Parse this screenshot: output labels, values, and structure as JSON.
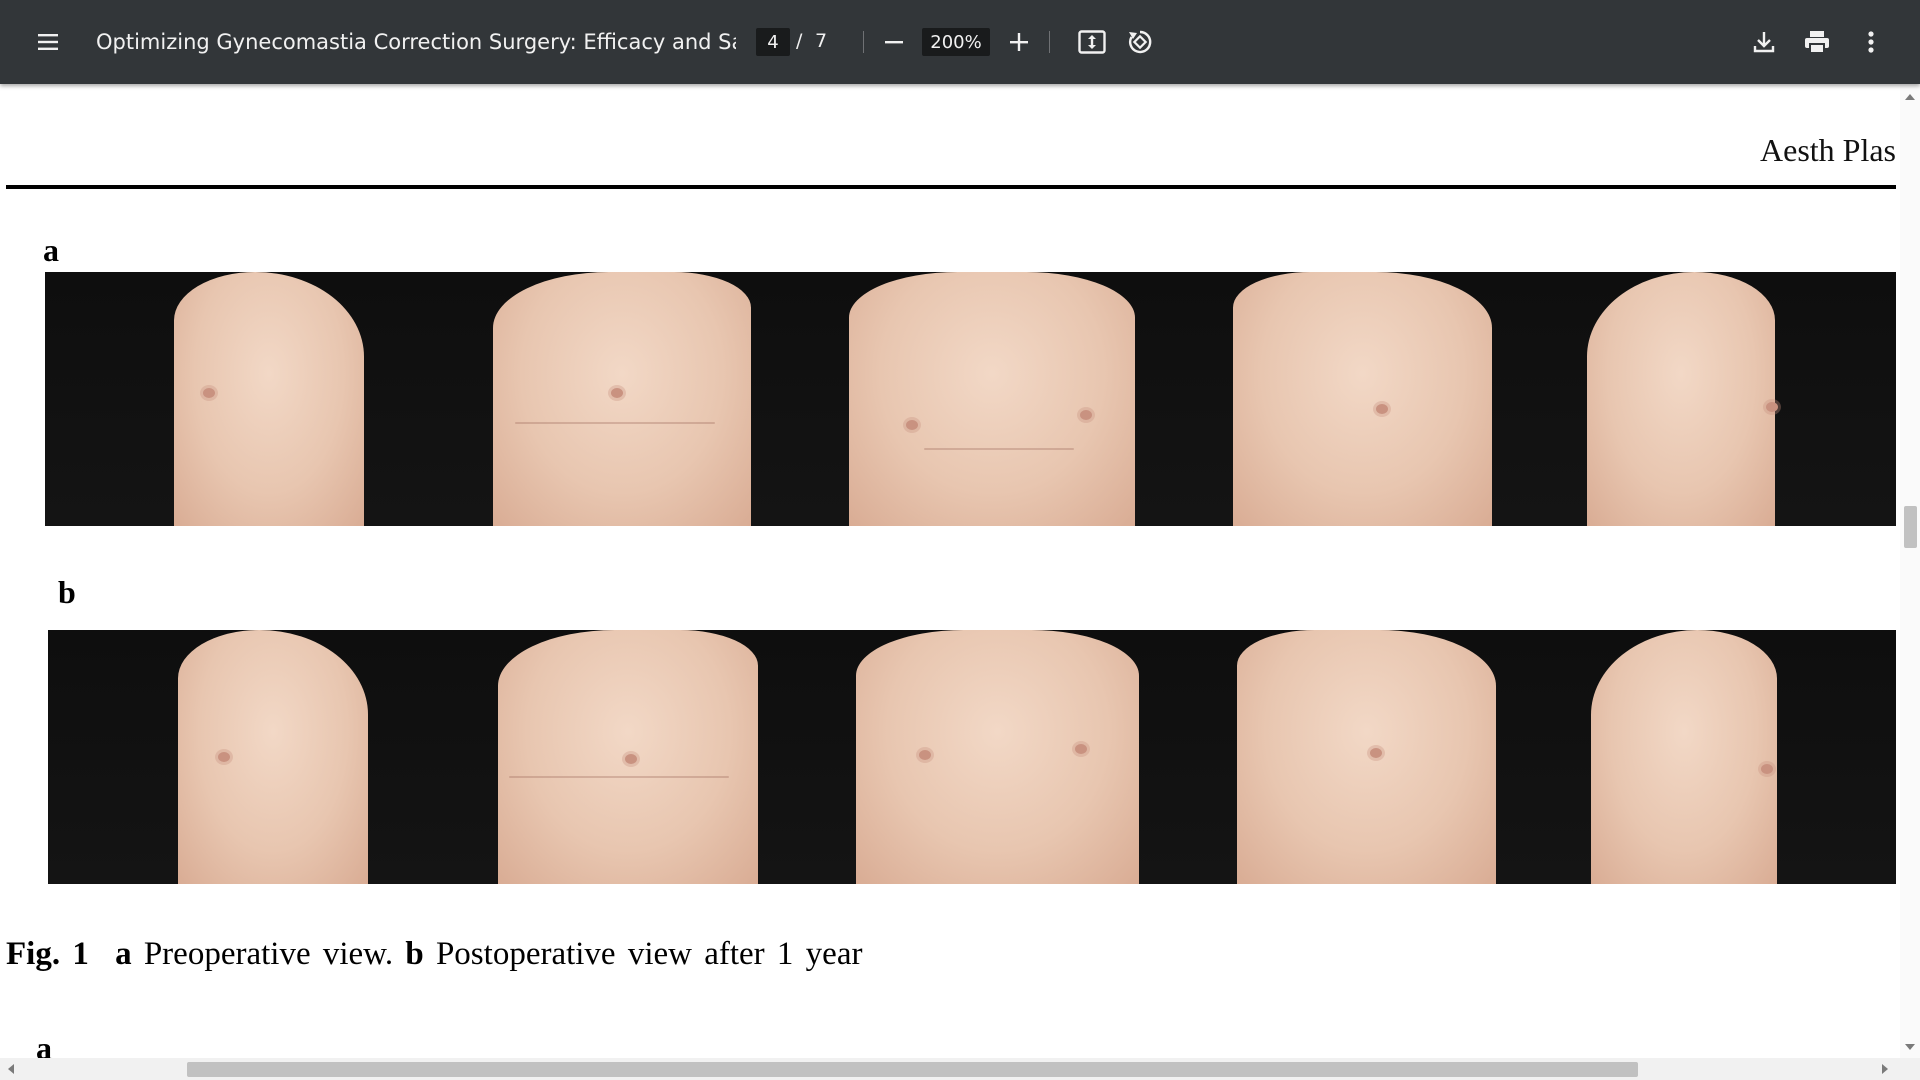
{
  "toolbar": {
    "title": "Optimizing Gynecomastia Correction Surgery: Efficacy and Safet...",
    "page_current": "4",
    "page_separator": "/",
    "page_total": "7",
    "zoom": "200%",
    "icons": [
      "menu-icon",
      "zoom-out-icon",
      "zoom-in-icon",
      "fit-page-icon",
      "rotate-icon",
      "download-icon",
      "print-icon",
      "more-vert-icon"
    ]
  },
  "document": {
    "journal_header": "Aesth Plas",
    "panel_a_label": "a",
    "panel_b_label": "b",
    "next_panel_label": "a",
    "caption": {
      "fig": "Fig. 1",
      "a": "a",
      "a_text": "Preoperative view.",
      "b": "b",
      "b_text": "Postoperative view after 1 year"
    }
  },
  "colors": {
    "toolbar_bg": "#323639",
    "toolbar_text": "#f1f1f1",
    "input_bg": "#191b1c",
    "page_bg": "#ffffff",
    "scrollbar_thumb": "#c1c1c1"
  }
}
